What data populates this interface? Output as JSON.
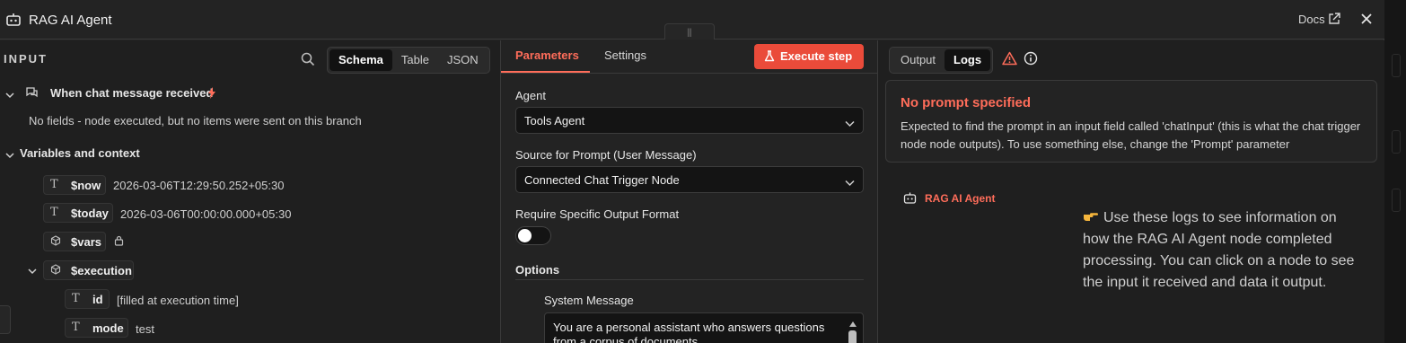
{
  "header": {
    "title": "RAG AI Agent",
    "docs_label": "Docs",
    "drag_glyph": "|||"
  },
  "input": {
    "label": "INPUT",
    "view_tabs": [
      "Schema",
      "Table",
      "JSON"
    ],
    "active_view": "Schema",
    "trigger_node": "When chat message received",
    "trigger_note": "No fields - node executed, but no items were sent on this branch",
    "context_title": "Variables and context",
    "vars": {
      "now": {
        "name": "$now",
        "value": "2026-03-06T12:29:50.252+05:30"
      },
      "today": {
        "name": "$today",
        "value": "2026-03-06T00:00:00.000+05:30"
      },
      "vars": {
        "name": "$vars"
      },
      "execution": {
        "name": "$execution"
      },
      "id": {
        "name": "id",
        "value": "[filled at execution time]"
      },
      "mode": {
        "name": "mode",
        "value": "test"
      }
    }
  },
  "params": {
    "tab_parameters": "Parameters",
    "tab_settings": "Settings",
    "execute_label": "Execute step",
    "agent_label": "Agent",
    "agent_value": "Tools Agent",
    "source_label": "Source for Prompt (User Message)",
    "source_value": "Connected Chat Trigger Node",
    "require_format_label": "Require Specific Output Format",
    "require_format_enabled": false,
    "options_title": "Options",
    "system_message_label": "System Message",
    "system_message_value": "You are a personal assistant who answers questions from a corpus of documents."
  },
  "output": {
    "view_tabs": [
      "Output",
      "Logs"
    ],
    "active_view": "Logs",
    "alert_title": "No prompt specified",
    "alert_text": "Expected to find the prompt in an input field called 'chatInput' (this is what the chat trigger node node outputs). To use something else, change the 'Prompt' parameter",
    "log_node": "RAG AI Agent",
    "hint": "Use these logs to see information on how the RAG AI Agent node completed processing. You can click on a node to see the input it received and data it output."
  },
  "colors": {
    "accent": "#ff6d5a",
    "execute_bg": "#ea4b3a",
    "background": "#232323"
  },
  "icons": [
    "robot-icon",
    "external-link-icon",
    "close-icon",
    "search-icon",
    "chat-icon",
    "bolt-icon",
    "chevron-down-icon",
    "text-type-icon",
    "cube-icon",
    "lock-icon",
    "flask-icon",
    "warning-icon",
    "info-icon",
    "pointing-hand-icon"
  ]
}
